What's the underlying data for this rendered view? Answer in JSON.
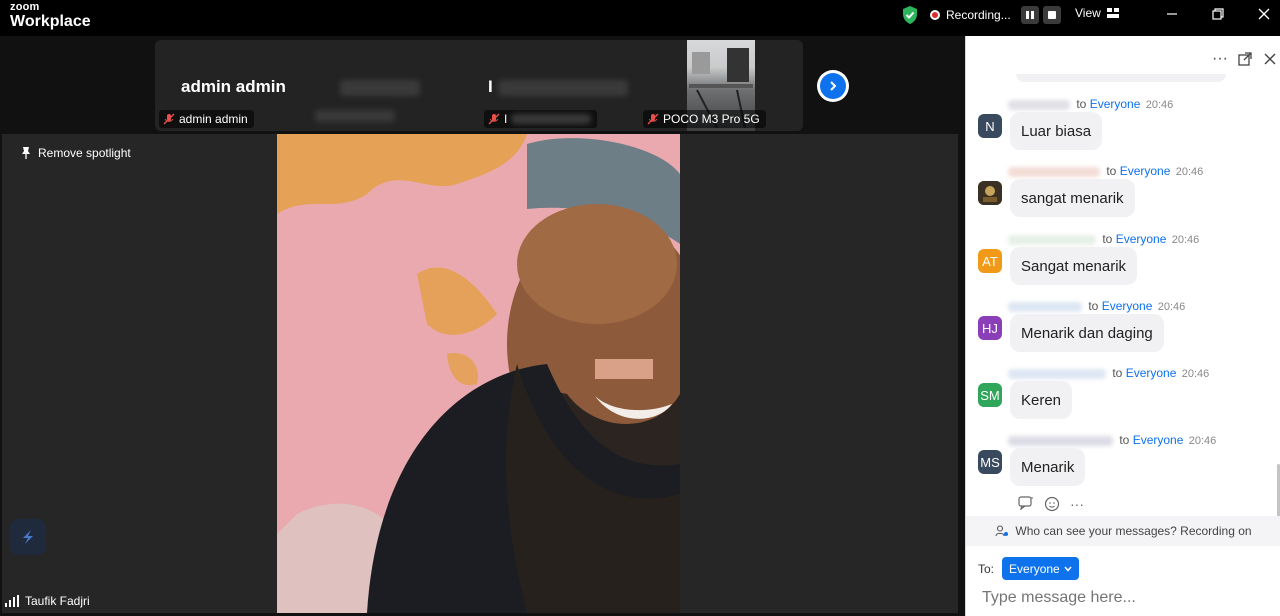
{
  "app": {
    "brand_small": "zoom",
    "brand_name": "Workplace"
  },
  "titlebar": {
    "recording_label": "Recording...",
    "view_label": "View",
    "colors": {
      "shield": "#2db55d",
      "record": "#e02b2b",
      "accent": "#0e72ed"
    }
  },
  "strip": {
    "tiles": [
      {
        "big_name": "admin admin",
        "label": "admin admin"
      },
      {
        "big_name": "I",
        "label": "I"
      },
      {
        "label": "POCO M3 Pro 5G"
      }
    ]
  },
  "stage": {
    "remove_spotlight": "Remove spotlight",
    "speaker_name": "Taufik Fadjri"
  },
  "chat": {
    "messages": [
      {
        "to": "to",
        "recipient": "Everyone",
        "time": "20:46",
        "avatar": "N",
        "avatar_color": "#3a4a5e",
        "text": "Luar biasa"
      },
      {
        "to": "to",
        "recipient": "Everyone",
        "time": "20:46",
        "avatar": "",
        "avatar_color": "#6b5a3a",
        "text": "sangat menarik"
      },
      {
        "to": "to",
        "recipient": "Everyone",
        "time": "20:46",
        "avatar": "AT",
        "avatar_color": "#f19a1a",
        "text": "Sangat menarik"
      },
      {
        "to": "to",
        "recipient": "Everyone",
        "time": "20:46",
        "avatar": "HJ",
        "avatar_color": "#8a3fb8",
        "text": "Menarik dan daging"
      },
      {
        "to": "to",
        "recipient": "Everyone",
        "time": "20:46",
        "avatar": "SM",
        "avatar_color": "#2fa65a",
        "text": "Keren"
      },
      {
        "to": "to",
        "recipient": "Everyone",
        "time": "20:46",
        "avatar": "MS",
        "avatar_color": "#3a4a5e",
        "text": "Menarik"
      }
    ],
    "notice": "Who can see your messages? Recording on",
    "to_label": "To:",
    "recipient_button": "Everyone",
    "input_placeholder": "Type message here..."
  }
}
